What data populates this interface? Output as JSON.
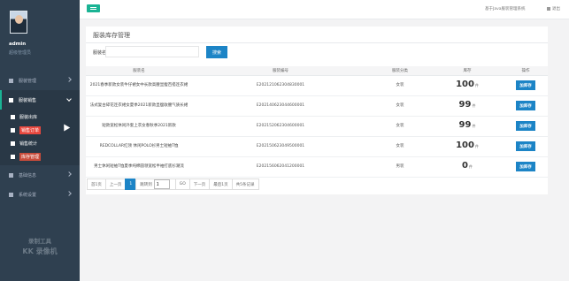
{
  "app": {
    "title": "服装库存管理"
  },
  "topbar": {
    "link1": "基于Java服装管理系统",
    "link2": "退出"
  },
  "sidebar": {
    "username": "admin",
    "role": "超级管理员",
    "menus": [
      {
        "label": "服装管理"
      },
      {
        "label": "服装销售"
      }
    ],
    "submenu": [
      {
        "label": "服装出库"
      },
      {
        "label": "销售订单"
      },
      {
        "label": "销售统计"
      },
      {
        "label": "库存管理"
      }
    ],
    "menus_after": [
      {
        "label": "基础信息"
      },
      {
        "label": "系统设置"
      }
    ],
    "watermark_line1": "录制工具",
    "watermark_line2": "KK 录像机"
  },
  "search": {
    "label": "服装名",
    "placeholder": "",
    "button": "搜索"
  },
  "table": {
    "headers": [
      "服装名",
      "服装编号",
      "服装分类",
      "库存",
      "操作"
    ],
    "rows": [
      {
        "name": "2021春季新款女装牛仔裙女中长款高腰显瘦百搭连衣裙",
        "code": "E202121062304830001",
        "category": "女装",
        "stock": "100",
        "unit": "件",
        "action": "加库存"
      },
      {
        "name": "法式复古碎花连衣裙女夏季2021新款显瘦收腰气质长裙",
        "code": "E202140623044600001",
        "category": "女装",
        "stock": "99",
        "unit": "件",
        "action": "加库存"
      },
      {
        "name": "短款宽松休闲外套上衣女春秋季2021新款",
        "code": "E202152062304600001",
        "category": "女装",
        "stock": "99",
        "unit": "件",
        "action": "加库存"
      },
      {
        "name": "REDCOLLAR红领 休闲POLO衫男士短袖T恤",
        "code": "E202150623049500001",
        "category": "女装",
        "stock": "100",
        "unit": "件",
        "action": "加库存"
      },
      {
        "name": "男士休闲短袖T恤夏季纯棉圆领宽松半袖打底衫潮流",
        "code": "E202156062041200001",
        "category": "男装",
        "stock": "0",
        "unit": "件",
        "action": "加库存"
      }
    ]
  },
  "pager": {
    "first": "首1页",
    "prev": "上一页",
    "current": "1",
    "goto_label": "跳转到",
    "goto_value": "1",
    "go": "GO",
    "next": "下一页",
    "last": "最后1页",
    "total": "共5条记录"
  }
}
